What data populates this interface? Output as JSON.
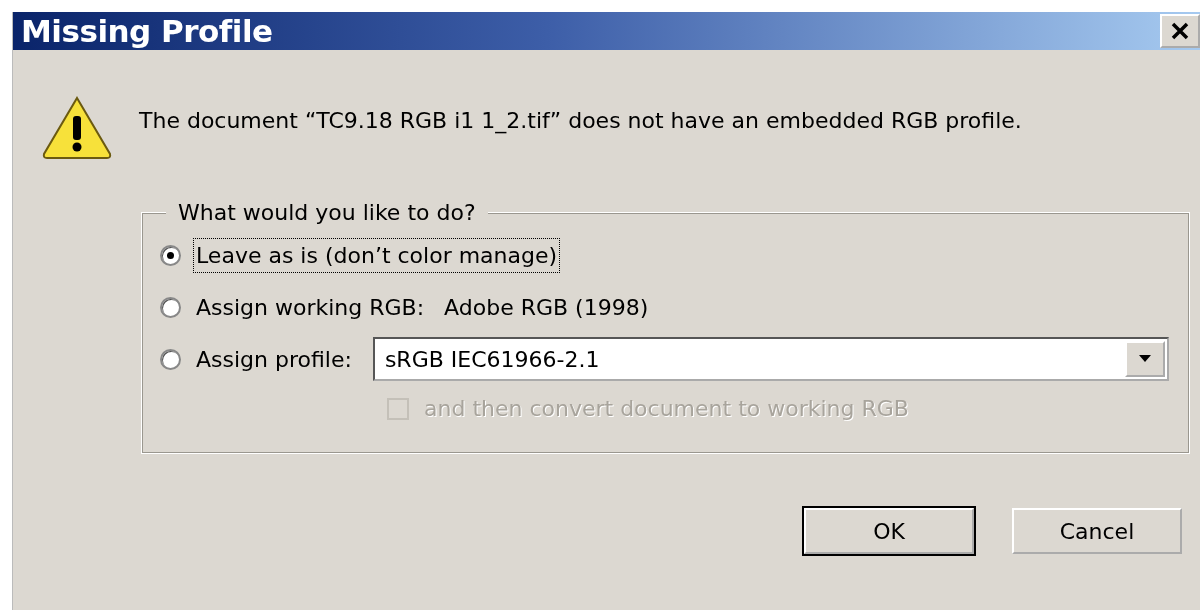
{
  "window": {
    "title": "Missing Profile"
  },
  "message": "The document “TC9.18 RGB i1 1_2.tif” does not have an embedded RGB profile.",
  "group": {
    "legend": "What would you like to do?",
    "options": [
      {
        "kind": "plain",
        "label": "Leave as is (don’t color manage)",
        "selected": true
      },
      {
        "kind": "value",
        "label": "Assign working RGB:",
        "value": "Adobe RGB (1998)",
        "selected": false
      },
      {
        "kind": "select",
        "label": "Assign profile:",
        "value": "sRGB IEC61966-2.1",
        "selected": false
      }
    ],
    "convert": {
      "label": "and then convert document to working RGB",
      "checked": false,
      "disabled": true
    }
  },
  "buttons": [
    {
      "label": "OK",
      "default": true
    },
    {
      "label": "Cancel",
      "default": false
    }
  ]
}
